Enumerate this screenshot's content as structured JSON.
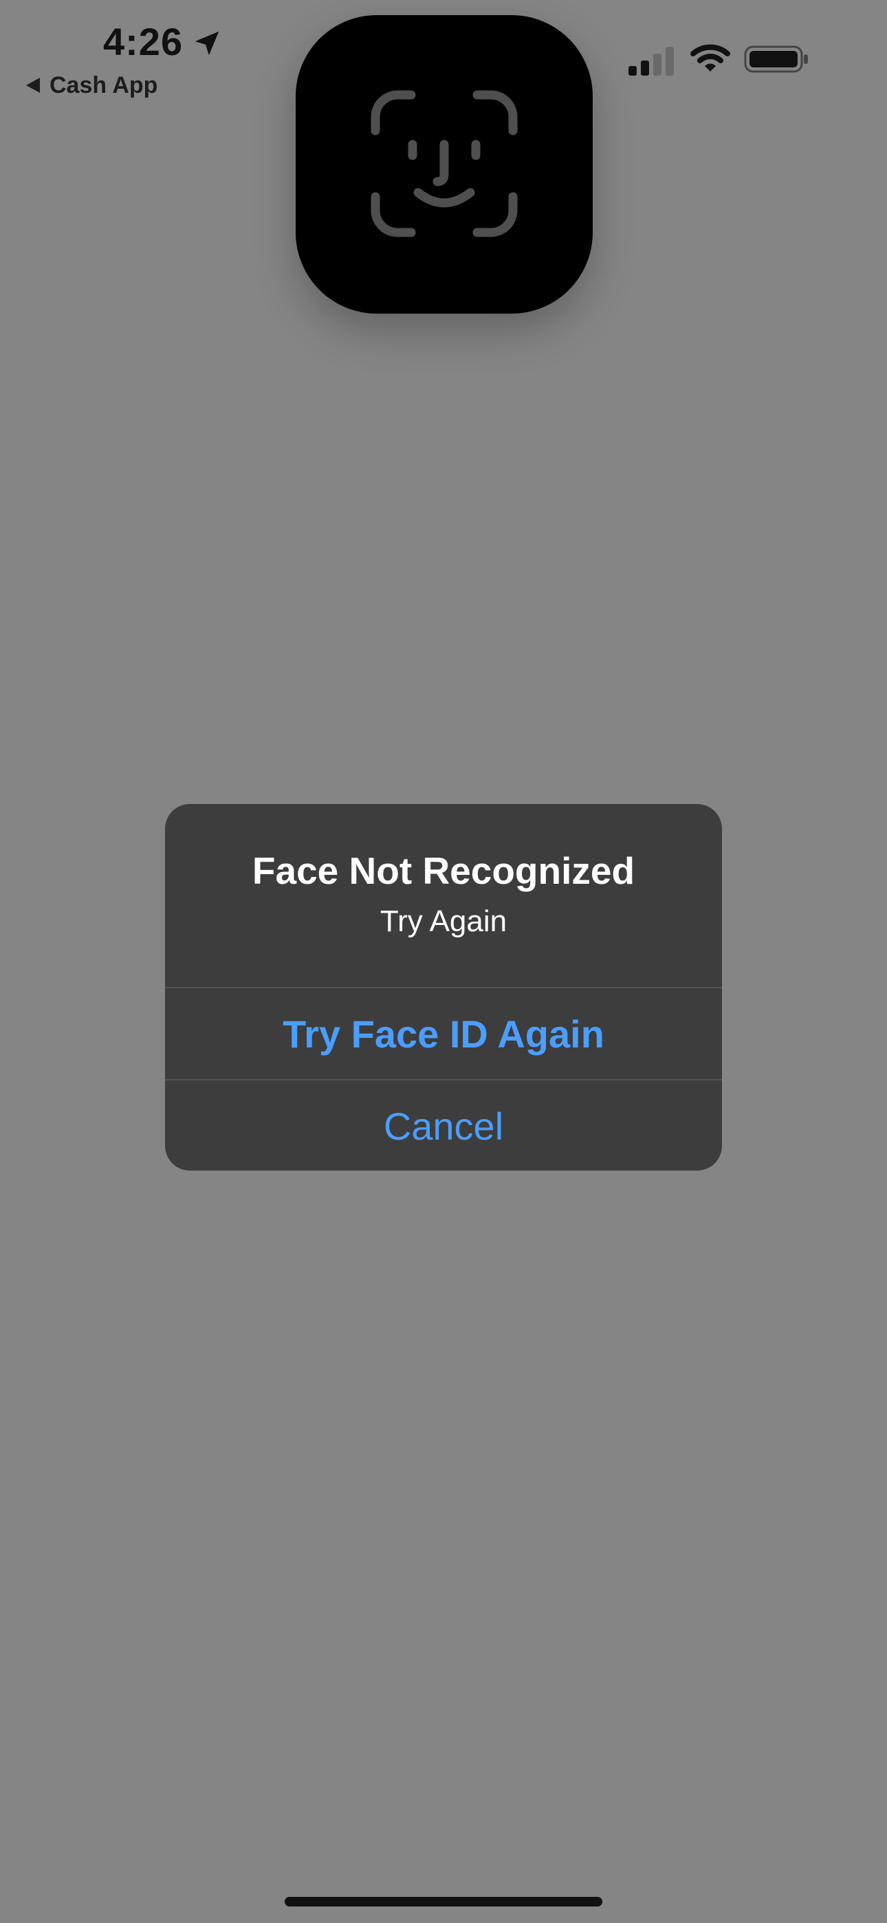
{
  "status_bar": {
    "time": "4:26",
    "back_app_label": "Cash App",
    "icons": [
      "location-arrow-icon",
      "cellular-signal-icon",
      "wifi-icon",
      "battery-icon"
    ]
  },
  "faceid_hud": {
    "icon": "face-id-icon"
  },
  "alert": {
    "title": "Face Not Recognized",
    "message": "Try Again",
    "primary_button": "Try Face ID Again",
    "cancel_button": "Cancel"
  },
  "colors": {
    "background_dimmed": "#858585",
    "alert_background": "#3d3d3d",
    "button_accent": "#4a9eff"
  }
}
